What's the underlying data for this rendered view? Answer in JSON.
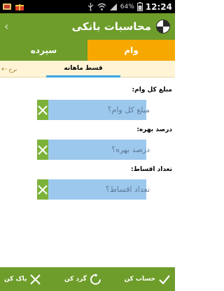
{
  "status_bar": {
    "battery_percent": "64%",
    "time": "12:24"
  },
  "app_bar": {
    "title": "محاسبات بانکی"
  },
  "main_tabs": [
    {
      "label": "سپرده",
      "active": false
    },
    {
      "label": "وام",
      "active": true
    }
  ],
  "sub_tabs": {
    "active_label": "قسط ماهانه",
    "rate_label": "نرخ"
  },
  "form": {
    "loan_amount": {
      "label": "مبلغ کل وام:",
      "placeholder": "مبلغ کل وام؟",
      "value": ""
    },
    "interest_rate": {
      "label": "درصد بهره:",
      "placeholder": "درصد بهره؟",
      "value": ""
    },
    "installments": {
      "label": "تعداد اقساط:",
      "placeholder": "تعداد اقساط؟",
      "value": ""
    }
  },
  "bottom_bar": {
    "calculate_label": "حساب کن",
    "round_label": "گرد کن",
    "clear_label": "پاک کن"
  },
  "colors": {
    "primary_green": "#6e9d2b",
    "tab_orange": "#f6a800",
    "input_blue": "#9dc8ee",
    "clear_green": "#7db23a",
    "sub_tab_bg": "#fff4d6",
    "active_indicator": "#3aa6e5"
  }
}
